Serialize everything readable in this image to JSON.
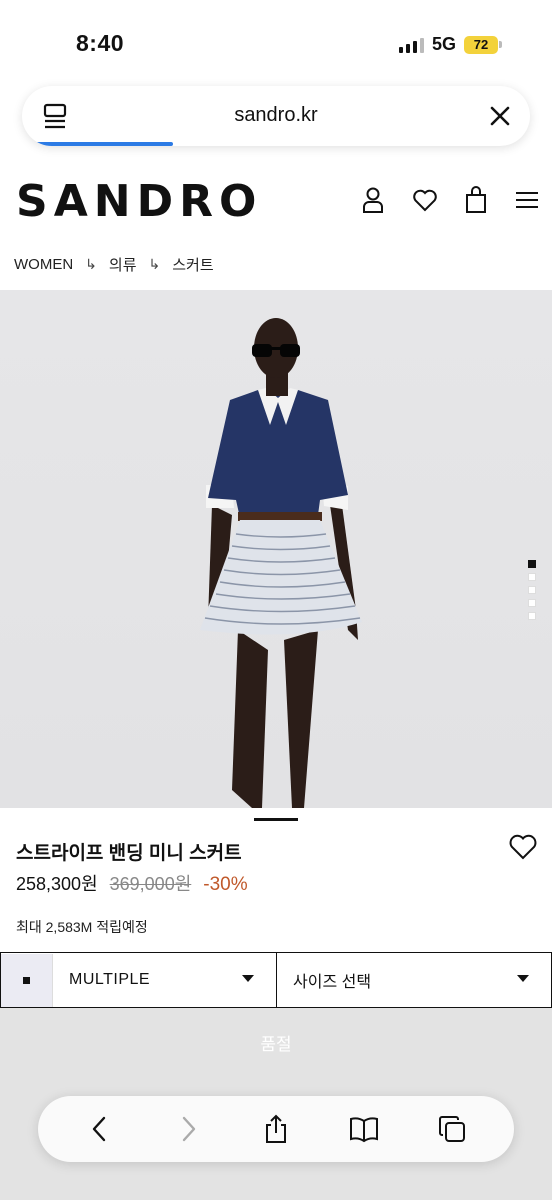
{
  "status": {
    "time": "8:40",
    "network": "5G",
    "battery": "72"
  },
  "browser": {
    "url": "sandro.kr",
    "load_progress": 0.27
  },
  "site": {
    "logo": "SANDRO"
  },
  "breadcrumb": [
    "WOMEN",
    "의류",
    "스커트"
  ],
  "gallery": {
    "slide_count": 5,
    "active_slide": 1
  },
  "product": {
    "name": "스트라이프 밴딩 미니 스커트",
    "price": "258,300원",
    "original_price": "369,000원",
    "discount": "-30%",
    "points": "최대 2,583M 적립예정"
  },
  "selectors": {
    "color_value": "MULTIPLE",
    "size_placeholder": "사이즈 선택"
  },
  "cta": {
    "label": "품절"
  },
  "colors": {
    "discount": "#c0592b",
    "progress": "#2c7be5",
    "battery": "#f3d23b",
    "soldout_bg": "#e3e3e3"
  },
  "icons": [
    "tabs-icon",
    "close-icon",
    "account-icon",
    "heart-icon",
    "bag-icon",
    "menu-icon",
    "back-icon",
    "forward-icon",
    "share-icon",
    "bookmarks-icon",
    "tabs-overview-icon"
  ]
}
